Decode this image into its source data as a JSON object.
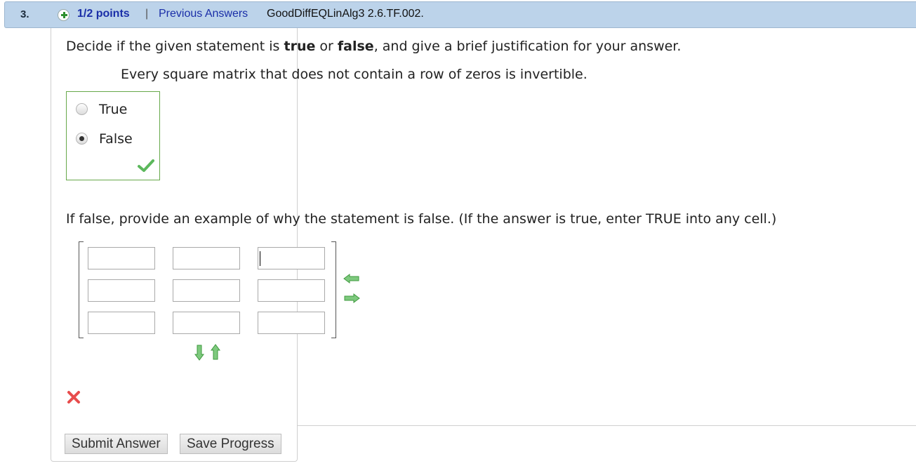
{
  "header": {
    "question_number": "3.",
    "points": "1/2 points",
    "separator": "|",
    "previous_answers": "Previous Answers",
    "question_id": "GoodDiffEQLinAlg3 2.6.TF.002."
  },
  "question": {
    "prompt_start": "Decide if the given statement is ",
    "prompt_true": "true",
    "prompt_or": " or ",
    "prompt_false": "false",
    "prompt_end": ", and give a brief justification for your answer.",
    "statement": "Every square matrix that does not contain a row of zeros is invertible.",
    "choices": [
      {
        "label": "True",
        "selected": false
      },
      {
        "label": "False",
        "selected": true
      }
    ],
    "choice_result": "correct",
    "followup": "If false, provide an example of why the statement is false. (If the answer is true, enter TRUE into any cell.)",
    "matrix": {
      "rows": 3,
      "cols": 3,
      "values": [
        [
          "",
          "",
          ""
        ],
        [
          "",
          "",
          ""
        ],
        [
          "",
          "",
          ""
        ]
      ]
    },
    "matrix_result": "incorrect"
  },
  "buttons": {
    "submit": "Submit Answer",
    "save": "Save Progress"
  },
  "icons": {
    "plus": "plus-circle-icon",
    "check": "checkmark-icon",
    "x": "x-mark-icon",
    "arrow_left": "arrow-left-icon",
    "arrow_right": "arrow-right-icon",
    "arrow_down": "arrow-down-icon",
    "arrow_up": "arrow-up-icon"
  },
  "colors": {
    "header_bg": "#bcd3ea",
    "link": "#1a2ea8",
    "correct": "#5cb85c",
    "incorrect": "#e84c4c"
  }
}
